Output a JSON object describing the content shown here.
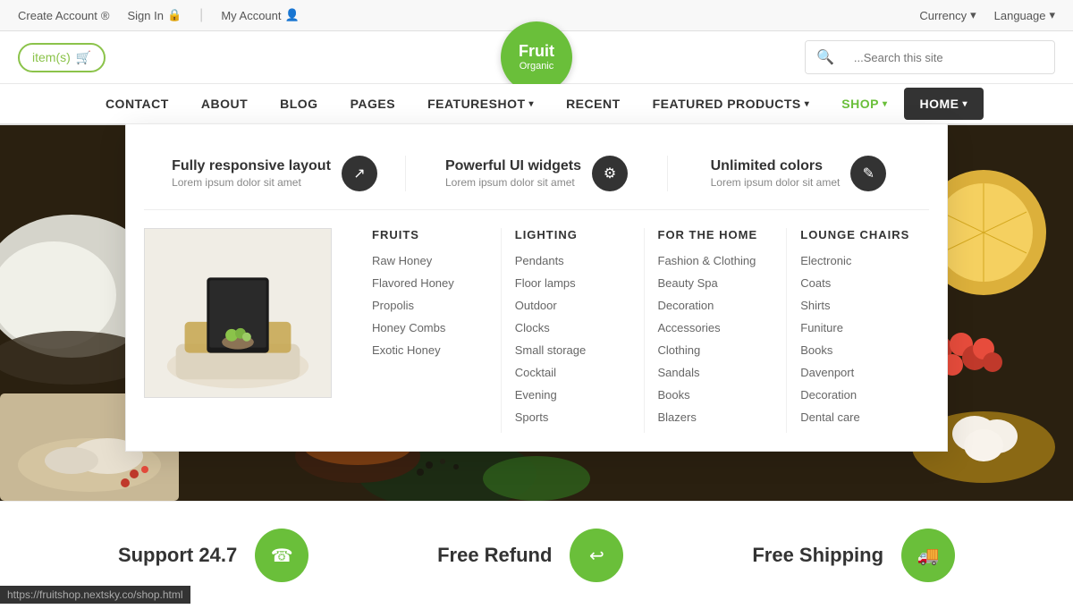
{
  "topbar": {
    "create_account": "Create Account",
    "sign_in": "Sign In",
    "my_account": "My Account",
    "currency": "Currency",
    "language": "Language"
  },
  "header": {
    "cart_label": "item(s)",
    "logo_fruit": "Fruit",
    "logo_organic": "Organic",
    "search_placeholder": "...Search this site"
  },
  "nav": {
    "items": [
      {
        "label": "CONTACT",
        "has_dropdown": false
      },
      {
        "label": "ABOUT",
        "has_dropdown": false
      },
      {
        "label": "BLOG",
        "has_dropdown": false
      },
      {
        "label": "PAGES",
        "has_dropdown": false
      },
      {
        "label": "FEATURESHOT",
        "has_dropdown": true
      },
      {
        "label": "RECENT",
        "has_dropdown": false
      },
      {
        "label": "FEATURED PRODUCTS",
        "has_dropdown": true
      },
      {
        "label": "SHOP",
        "has_dropdown": true,
        "class": "shop"
      },
      {
        "label": "HOME",
        "has_dropdown": true,
        "class": "home"
      }
    ]
  },
  "mega_menu": {
    "features": [
      {
        "title": "Fully responsive layout",
        "desc": "Lorem ipsum dolor sit amet",
        "icon": "↗"
      },
      {
        "title": "Powerful UI widgets",
        "desc": "Lorem ipsum dolor sit amet",
        "icon": "⚙"
      },
      {
        "title": "Unlimited colors",
        "desc": "Lorem ipsum dolor sit amet",
        "icon": "✎"
      }
    ],
    "columns": [
      {
        "header": "FRUITS",
        "items": [
          "Raw Honey",
          "Flavored Honey",
          "Propolis",
          "Honey Combs",
          "Exotic Honey"
        ]
      },
      {
        "header": "LIGHTING",
        "items": [
          "Pendants",
          "Floor lamps",
          "Outdoor",
          "Clocks",
          "Small storage",
          "Cocktail",
          "Evening",
          "Sports"
        ]
      },
      {
        "header": "FOR THE HOME",
        "items": [
          "Fashion & Clothing",
          "Beauty Spa",
          "Decoration",
          "Accessories",
          "Clothing",
          "Sandals",
          "Books",
          "Blazers"
        ]
      },
      {
        "header": "LOUNGE CHAIRS",
        "items": [
          "Electronic",
          "Coats",
          "Shirts",
          "Funiture",
          "Books",
          "Davenport",
          "Decoration",
          "Dental care"
        ]
      }
    ]
  },
  "bottom": {
    "features": [
      {
        "title": "Support 24.7",
        "icon": "☎"
      },
      {
        "title": "Free Refund",
        "icon": "↩"
      },
      {
        "title": "Free Shipping",
        "icon": "🚚"
      }
    ]
  },
  "status_url": "https://fruitshop.nextsky.co/shop.html"
}
